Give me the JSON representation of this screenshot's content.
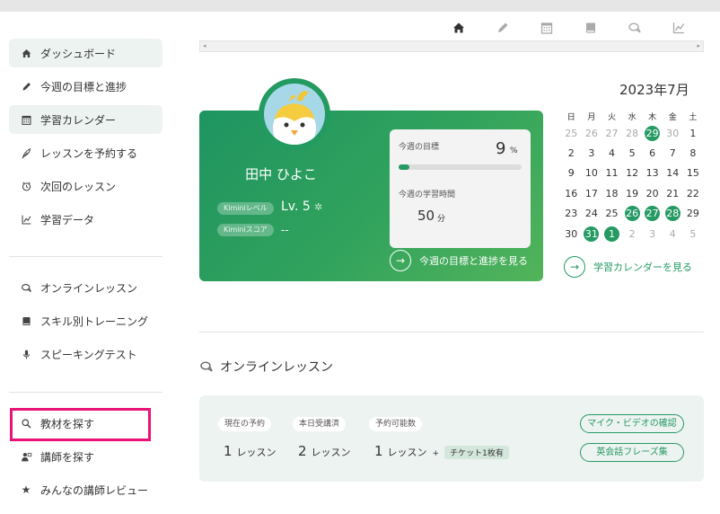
{
  "top_nav": [
    {
      "name": "home-icon",
      "active": true
    },
    {
      "name": "pencil-icon",
      "active": false
    },
    {
      "name": "calendar-icon",
      "active": false
    },
    {
      "name": "book-icon",
      "active": false
    },
    {
      "name": "chat-icon",
      "active": false
    },
    {
      "name": "chart-icon",
      "active": false
    }
  ],
  "sidebar": {
    "group1": [
      {
        "label": "ダッシュボード",
        "icon": "home-icon"
      },
      {
        "label": "今週の目標と進捗",
        "icon": "pencil-icon"
      },
      {
        "label": "学習カレンダー",
        "icon": "calendar-icon"
      },
      {
        "label": "レッスンを予約する",
        "icon": "feather-icon"
      },
      {
        "label": "次回のレッスン",
        "icon": "clock-icon"
      },
      {
        "label": "学習データ",
        "icon": "chart-icon"
      }
    ],
    "group2": [
      {
        "label": "オンラインレッスン",
        "icon": "chat-icon"
      },
      {
        "label": "スキル別トレーニング",
        "icon": "book-icon"
      },
      {
        "label": "スピーキングテスト",
        "icon": "mic-icon"
      }
    ],
    "group3": [
      {
        "label": "教材を探す",
        "icon": "search-icon"
      },
      {
        "label": "講師を探す",
        "icon": "teacher-icon"
      },
      {
        "label": "みんなの講師レビュー",
        "icon": "star-icon"
      }
    ]
  },
  "profile": {
    "name": "田中 ひよこ",
    "level_tag": "Kiminiレベル",
    "level_value": "Lv. 5",
    "score_tag": "Kiminiスコア",
    "score_value": "--"
  },
  "goal": {
    "label": "今週の目標",
    "value": "9",
    "unit": "%",
    "progress": 0.09,
    "time_label": "今週の学習時間",
    "time_value": "50",
    "time_unit": "分",
    "link": "今週の目標と進捗を見る"
  },
  "calendar": {
    "title": "2023年7月",
    "weekdays": [
      "日",
      "月",
      "火",
      "水",
      "木",
      "金",
      "土"
    ],
    "weeks": [
      [
        "25",
        "26",
        "27",
        "28",
        "29",
        "30",
        "1"
      ],
      [
        "2",
        "3",
        "4",
        "5",
        "6",
        "7",
        "8"
      ],
      [
        "9",
        "10",
        "11",
        "12",
        "13",
        "14",
        "15"
      ],
      [
        "16",
        "17",
        "18",
        "19",
        "20",
        "21",
        "22"
      ],
      [
        "23",
        "24",
        "25",
        "26",
        "27",
        "28",
        "29"
      ],
      [
        "30",
        "31",
        "1",
        "2",
        "3",
        "4",
        "5"
      ]
    ],
    "link": "学習カレンダーを見る"
  },
  "online": {
    "title": "オンラインレッスン",
    "current_label": "現在の予約",
    "current_value": "1",
    "today_label": "本日受講済",
    "today_value": "2",
    "avail_label": "予約可能数",
    "avail_value": "1",
    "unit": "レッスン",
    "plus": "+",
    "ticket": "チケット1枚有",
    "btn_mic": "マイク・ビデオの確認",
    "btn_phrase": "英会話フレーズ集"
  },
  "colors": {
    "accent": "#259a63",
    "highlight_box": "#ea1277"
  }
}
